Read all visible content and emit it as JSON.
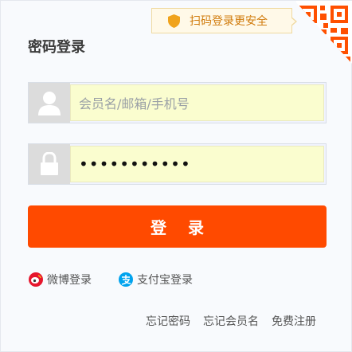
{
  "qr_tip": {
    "text": "扫码登录更安全"
  },
  "title": "密码登录",
  "username": {
    "placeholder": "会员名/邮箱/手机号"
  },
  "password": {
    "value": "•••••••••••"
  },
  "login_button": "登 录",
  "social": [
    {
      "label": "微博登录",
      "icon": "weibo-icon"
    },
    {
      "label": "支付宝登录",
      "icon": "alipay-icon"
    }
  ],
  "links": [
    "忘记密码",
    "忘记会员名",
    "免费注册"
  ],
  "colors": {
    "accent": "#ff4a00",
    "tip_text": "#d07a0a",
    "input_bg": "#fafdcf"
  }
}
